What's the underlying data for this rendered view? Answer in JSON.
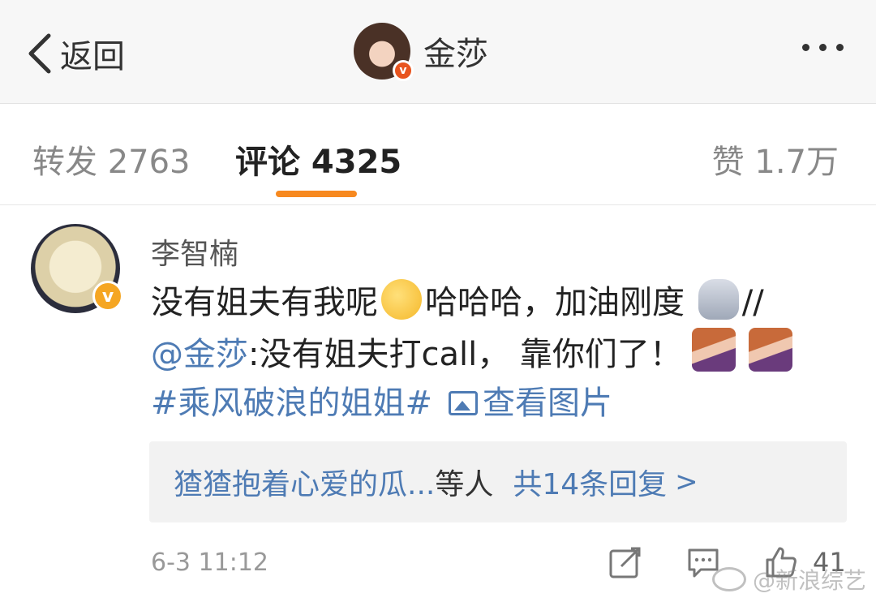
{
  "header": {
    "back_label": "返回",
    "title": "金莎",
    "avatar_icon": "profile-avatar",
    "verified_badge": "v",
    "more_icon": "more-dots-icon"
  },
  "tabs": {
    "reposts": "转发 2763",
    "comments": "评论 4325",
    "likes": "赞 1.7万",
    "active": "comments",
    "accent_color": "#f7891f"
  },
  "comment": {
    "author": "李智楠",
    "verified_badge": "v",
    "line1_text": "没有姐夫有我呢",
    "line1_text2": "哈哈哈，加油刚度",
    "line1_tail": "//",
    "line2_mention": "@金莎",
    "line2_text": ":没有姐夫打call，  靠你们了！",
    "line3_hashtag": "#乘风破浪的姐姐#",
    "line3_view_image": "查看图片",
    "replies_who": "猹猹抱着心爱的瓜...",
    "replies_etc": "等人",
    "replies_count": "共14条回复",
    "replies_chevron": ">",
    "timestamp": "6-3 11:12",
    "like_count": "41",
    "link_color": "#4e7bb4"
  },
  "watermark": "@新浪综艺"
}
